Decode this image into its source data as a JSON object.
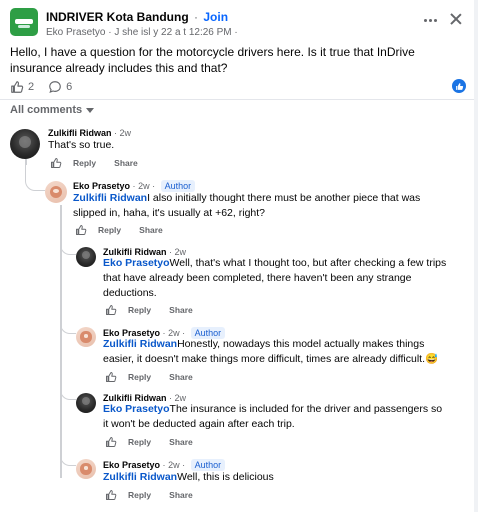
{
  "post": {
    "group_name": "INDRIVER Kota Bandung",
    "separator": "·",
    "join_label": "Join",
    "meta": "Eko Prasetyo · J she isl y 22 a t 12:26 PM ·",
    "text": "Hello, I have a question for the motorcycle drivers here. Is it true that InDrive insurance already includes this and that?",
    "like_count": "2",
    "comment_count": "6",
    "accent_color": "#1b74e4"
  },
  "comments_header": {
    "sort_label": "All comments"
  },
  "comments": [
    {
      "author": "Zulkifli Ridwan",
      "time": "2w",
      "badge": "",
      "mention": "",
      "text": "That's so true.",
      "reply_label": "Reply",
      "share_label": "Share"
    },
    {
      "author": "Eko Prasetyo",
      "time": "2w",
      "badge": "Author",
      "mention": "Zulkifli Ridwan",
      "text": "I also initially thought there must be another piece that was slipped in, haha, it's usually at +62, right?",
      "reply_label": "Reply",
      "share_label": "Share"
    },
    {
      "author": "Zulkifli Ridwan",
      "time": "2w",
      "badge": "",
      "mention": "Eko Prasetyo",
      "text": "Well, that's what I thought too, but after checking a few trips that have already been completed, there haven't been any strange deductions.",
      "reply_label": "Reply",
      "share_label": "Share"
    },
    {
      "author": "Eko Prasetyo",
      "time": "2w",
      "badge": "Author",
      "mention": "Zulkifli Ridwan",
      "text": "Honestly, nowadays this model actually makes things easier, it doesn't make things more difficult, times are already difficult.",
      "emoji": "😅",
      "reply_label": "Reply",
      "share_label": "Share"
    },
    {
      "author": "Zulkifli Ridwan",
      "time": "2w",
      "badge": "",
      "mention": "Eko Prasetyo",
      "text": "The insurance is included for the driver and passengers so it won't be deducted again after each trip.",
      "reply_label": "Reply",
      "share_label": "Share"
    },
    {
      "author": "Eko Prasetyo",
      "time": "2w",
      "badge": "Author",
      "mention": "Zulkifli Ridwan",
      "text": "Well, this is delicious",
      "reply_label": "Reply",
      "share_label": "Share"
    }
  ]
}
